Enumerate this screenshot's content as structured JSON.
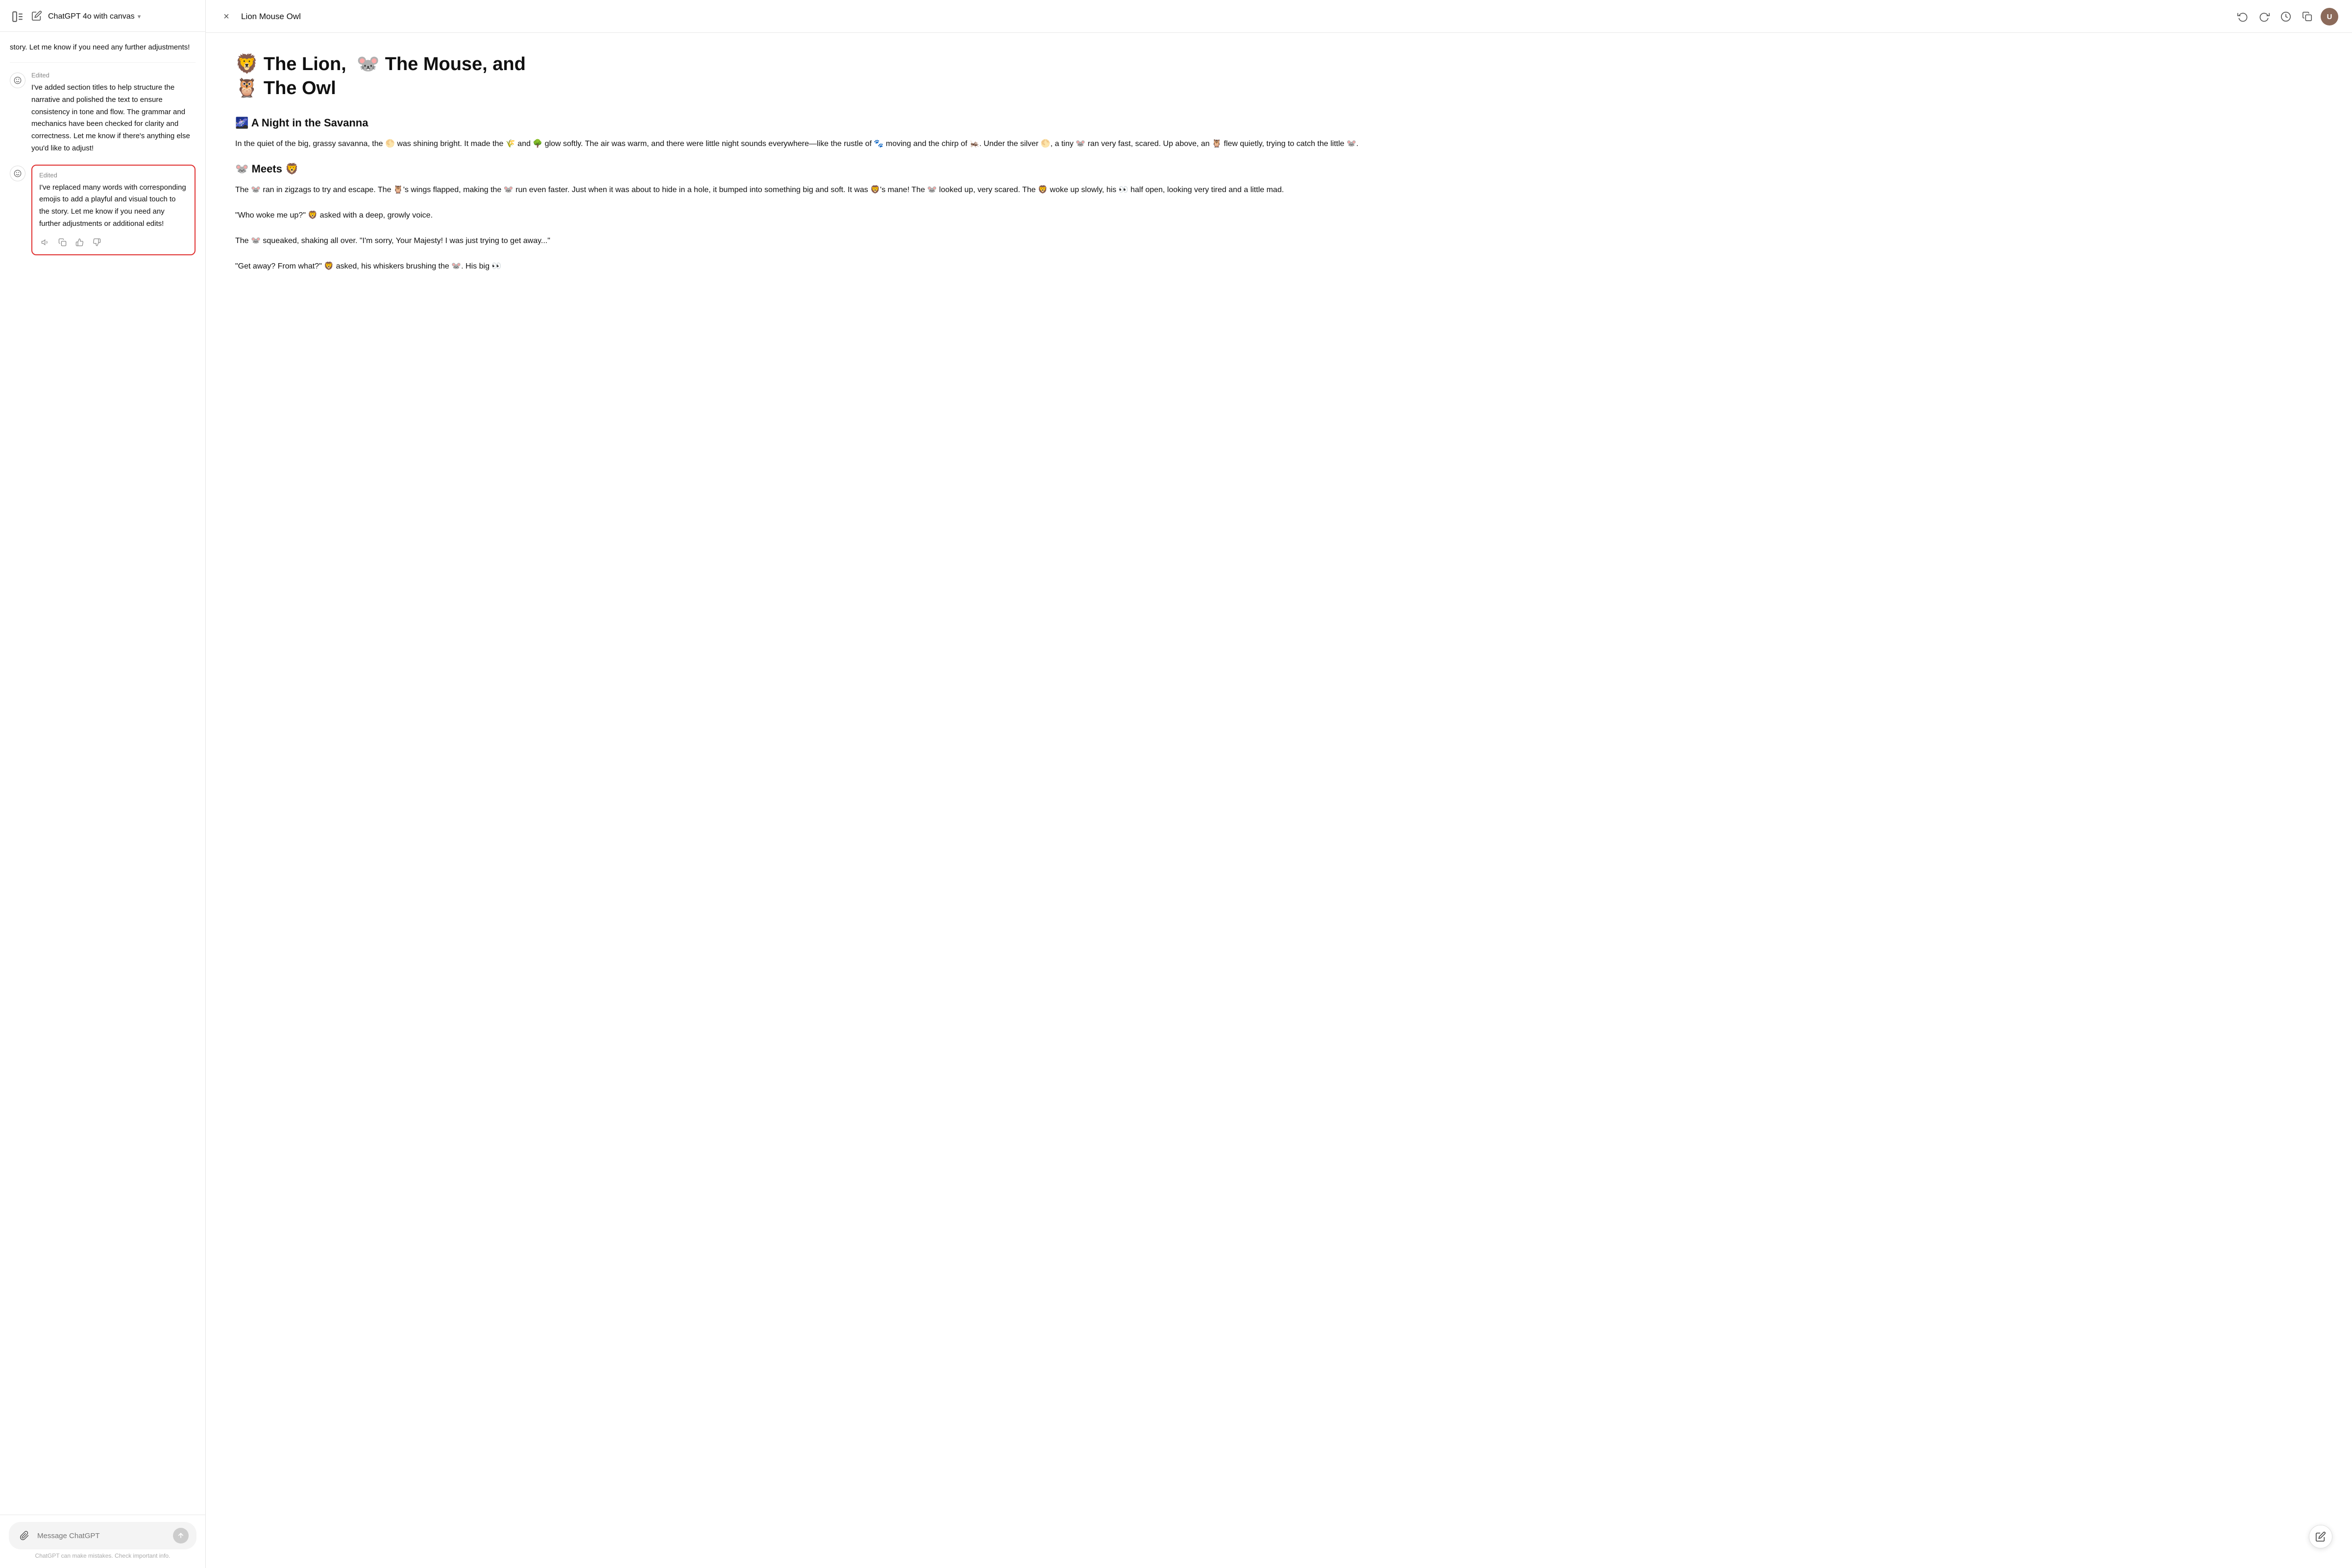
{
  "left": {
    "header": {
      "title": "ChatGPT 4o with canvas",
      "chevron": "▾"
    },
    "prev_message": {
      "text": "story. Let me know if you need any further adjustments!"
    },
    "messages": [
      {
        "id": "msg1",
        "label": "Edited",
        "text": "I've added section titles to help structure the narrative and polished the text to ensure consistency in tone and flow. The grammar and mechanics have been checked for clarity and correctness. Let me know if there's anything else you'd like to adjust!",
        "highlighted": false
      },
      {
        "id": "msg2",
        "label": "Edited",
        "text": "I've replaced many words with corresponding emojis to add a playful and visual touch to the story. Let me know if you need any further adjustments or additional edits!",
        "highlighted": true
      }
    ],
    "input": {
      "placeholder": "Message ChatGPT"
    },
    "disclaimer": "ChatGPT can make mistakes. Check important info."
  },
  "right": {
    "header": {
      "title": "Lion Mouse Owl",
      "close_label": "×"
    },
    "content": {
      "title": "🦁 The Lion,  🐭  The Mouse, and 🦉  The Owl",
      "sections": [
        {
          "id": "section1",
          "title": "🌌 A Night in the Savanna",
          "paragraphs": [
            "In the quiet of the big, grassy savanna, the 🌕 was shining bright. It made the 🌾 and 🌳 glow softly. The air was warm, and there were little night sounds everywhere—like the rustle of 🐾 moving and the chirp of 🦗. Under the silver 🌕, a tiny 🐭 ran very fast, scared. Up above, an 🦉 flew quietly, trying to catch the little 🐭."
          ]
        },
        {
          "id": "section2",
          "title": "🐭 Meets 🦁",
          "paragraphs": [
            "The 🐭 ran in zigzags to try and escape. The 🦉's wings flapped, making the 🐭 run even faster. Just when it was about to hide in a hole, it bumped into something big and soft. It was 🦁's mane! The 🐭 looked up, very scared. The 🦁 woke up slowly, his 👀 half open, looking very tired and a little mad.",
            "\"Who woke me up?\" 🦁 asked with a deep, growly voice.",
            "The 🐭 squeaked, shaking all over. \"I'm sorry, Your Majesty! I was just trying to get away...\"",
            "\"Get away? From what?\" 🦁 asked, his whiskers brushing the 🐭. His big 👀"
          ]
        }
      ]
    }
  }
}
